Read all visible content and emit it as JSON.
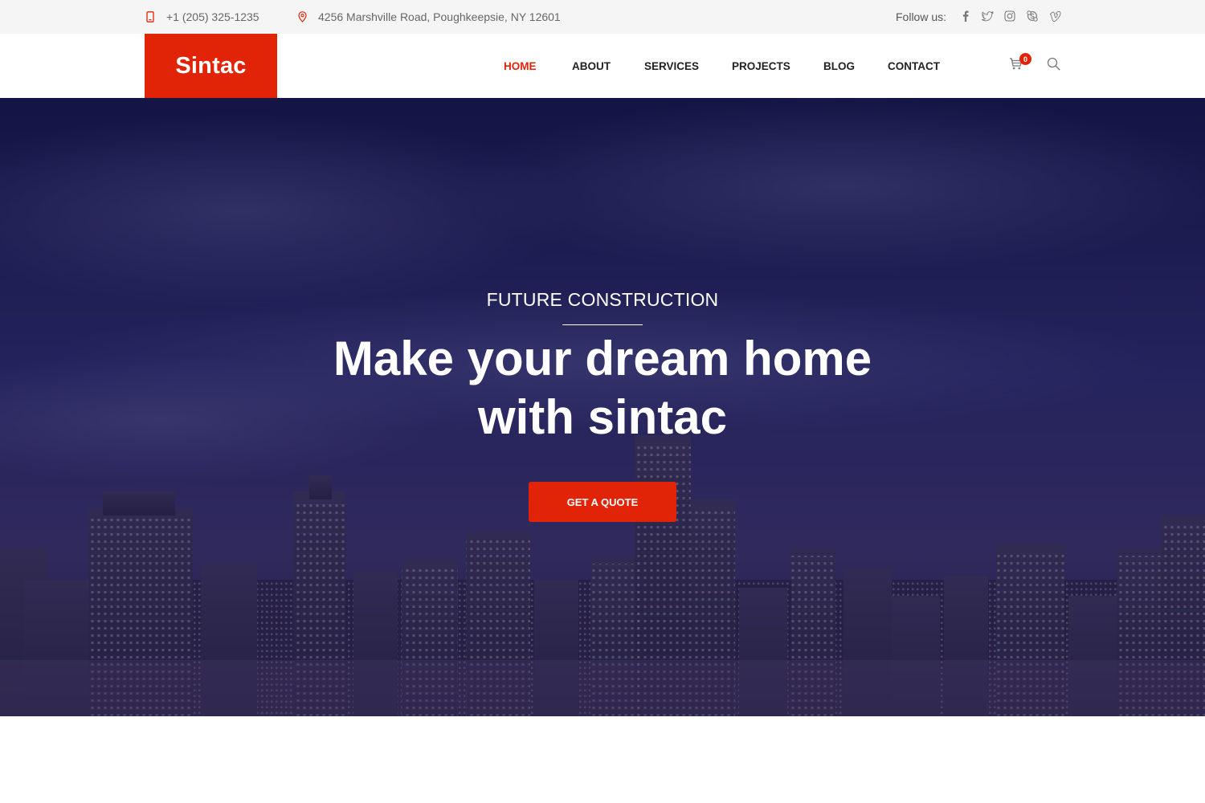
{
  "topbar": {
    "phone": "+1 (205) 325-1235",
    "address": "4256 Marshville Road, Poughkeepsie, NY 12601",
    "follow_label": "Follow us:",
    "socials": [
      "facebook-icon",
      "twitter-icon",
      "instagram-icon",
      "skype-icon",
      "vimeo-icon"
    ]
  },
  "header": {
    "logo": "Sintac",
    "nav": [
      {
        "label": "HOME"
      },
      {
        "label": "ABOUT"
      },
      {
        "label": "SERVICES"
      },
      {
        "label": "PROJECTS"
      },
      {
        "label": "BLOG"
      },
      {
        "label": "CONTACT"
      }
    ],
    "cart_count": "0"
  },
  "hero": {
    "subtitle": "FUTURE CONSTRUCTION",
    "title_line1": "Make your dream home",
    "title_line2": "with sintac",
    "button": "GET A QUOTE"
  },
  "colors": {
    "accent": "#e12408",
    "topbar_bg": "#f5f5f5",
    "hero_overlay": "#1c184e"
  }
}
